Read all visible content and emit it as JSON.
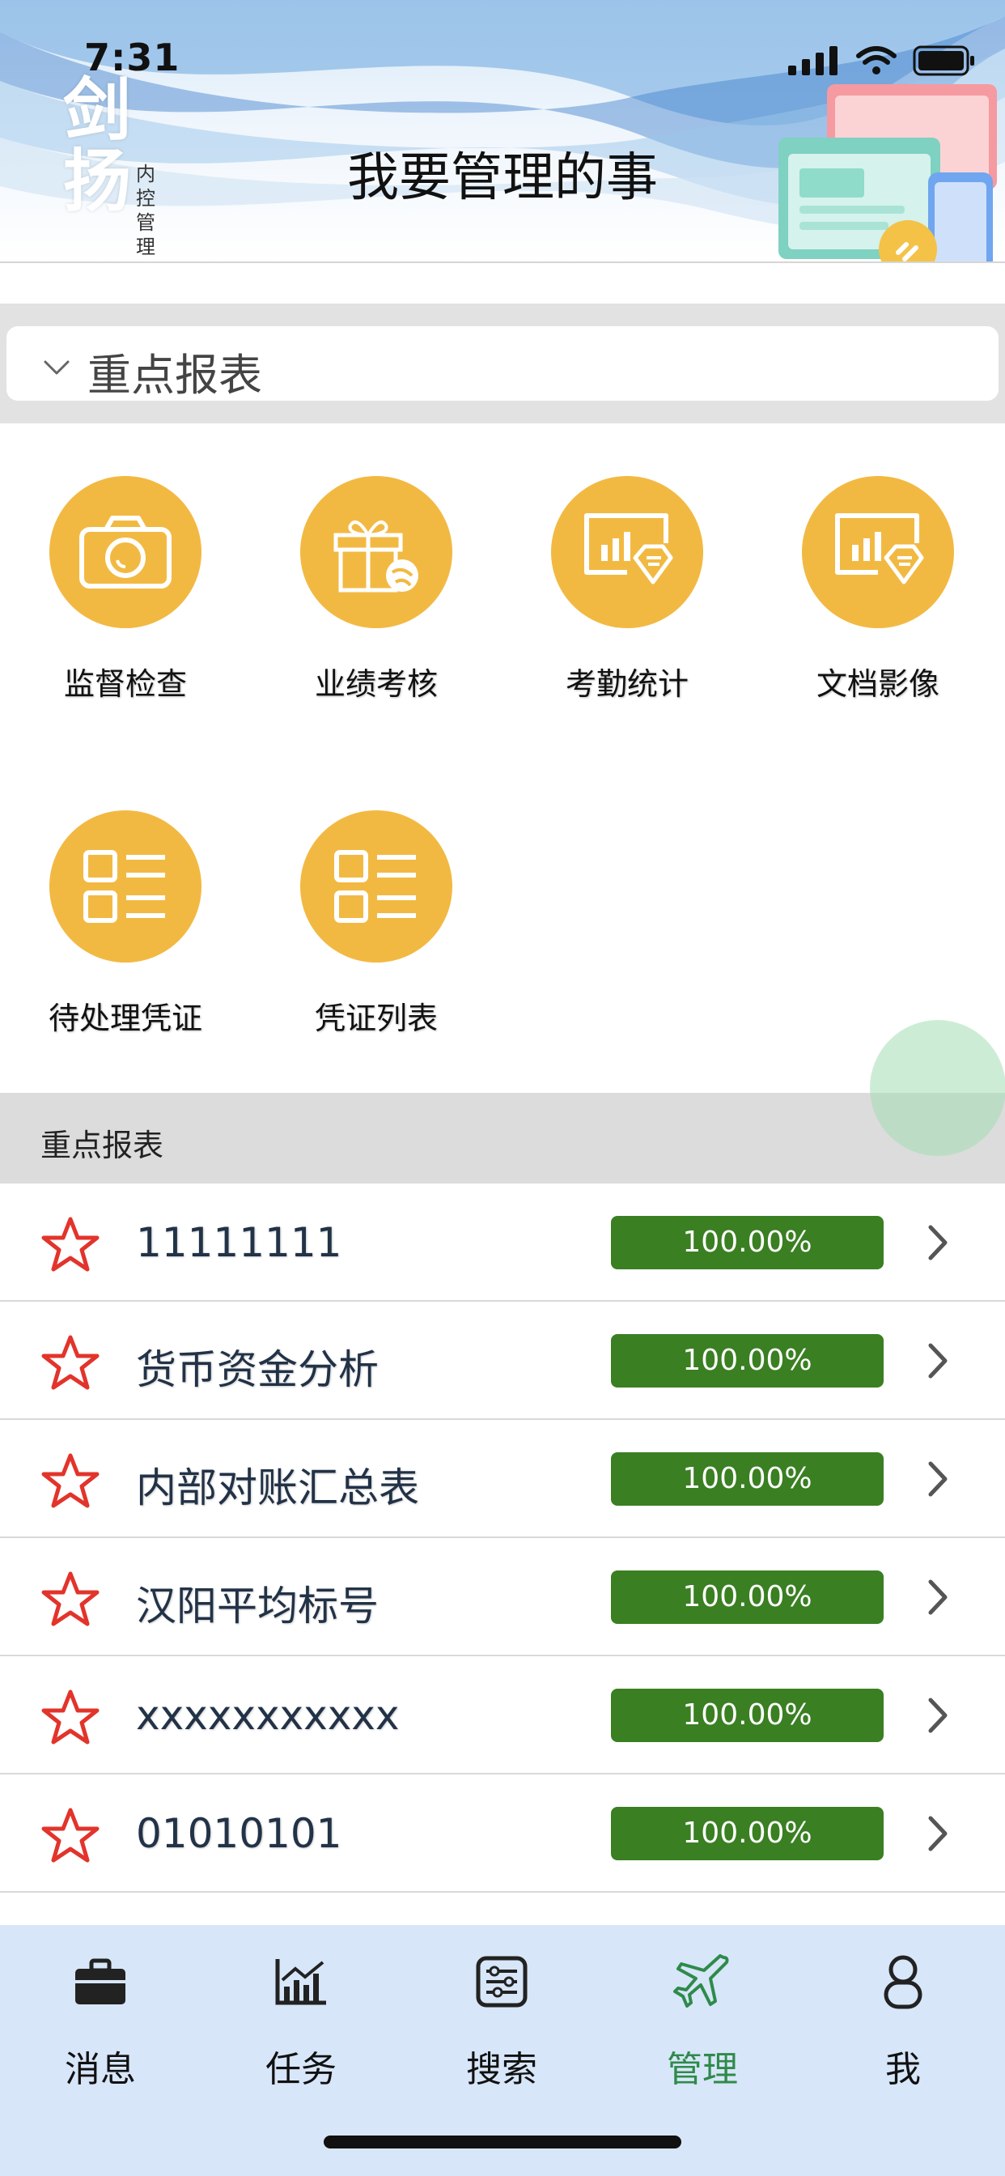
{
  "status_bar": {
    "time": "7:31"
  },
  "header": {
    "logo_text": "剑扬",
    "logo_subtext": "内控管理",
    "title": "我要管理的事"
  },
  "selector": {
    "label": "重点报表"
  },
  "grid": {
    "items": [
      {
        "label": "监督检查",
        "icon": "camera-icon"
      },
      {
        "label": "业绩考核",
        "icon": "gift-icon"
      },
      {
        "label": "考勤统计",
        "icon": "report-diamond-icon"
      },
      {
        "label": "文档影像",
        "icon": "report-diamond-icon"
      },
      {
        "label": "待处理凭证",
        "icon": "list-icon"
      },
      {
        "label": "凭证列表",
        "icon": "list-icon"
      }
    ]
  },
  "list": {
    "header": "重点报表",
    "rows": [
      {
        "label": "11111111",
        "progress": "100.00%"
      },
      {
        "label": "货币资金分析",
        "progress": "100.00%"
      },
      {
        "label": "内部对账汇总表",
        "progress": "100.00%"
      },
      {
        "label": "汉阳平均标号",
        "progress": "100.00%"
      },
      {
        "label": "xxxxxxxxxxx",
        "progress": "100.00%"
      },
      {
        "label": "01010101",
        "progress": "100.00%"
      }
    ]
  },
  "tabbar": {
    "tabs": [
      {
        "label": "消息",
        "icon": "briefcase-icon"
      },
      {
        "label": "任务",
        "icon": "chart-icon"
      },
      {
        "label": "搜索",
        "icon": "search-panel-icon"
      },
      {
        "label": "管理",
        "icon": "airplane-icon",
        "active": true
      },
      {
        "label": "我",
        "icon": "person-icon"
      }
    ]
  },
  "colors": {
    "accent_yellow": "#f2b942",
    "progress_green": "#3a7f22",
    "active_tab": "#2f8a4a",
    "tabbar_bg": "#d7e6f8",
    "star_red": "#e2342b"
  }
}
